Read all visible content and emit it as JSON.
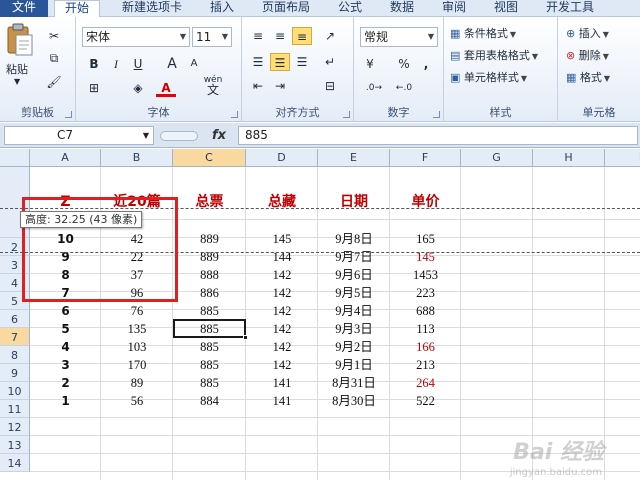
{
  "tabs": [
    "文件",
    "开始",
    "新建选项卡",
    "插入",
    "页面布局",
    "公式",
    "数据",
    "审阅",
    "视图",
    "开发工具"
  ],
  "ribbon": {
    "clipboard": {
      "label": "剪贴板",
      "paste": "粘贴"
    },
    "font": {
      "label": "字体",
      "name": "宋体",
      "size": "11",
      "bold": "B",
      "italic": "I",
      "underline": "U",
      "grow": "A",
      "shrink": "A",
      "color_a": "A",
      "wen": "wén",
      "wen_char": "文"
    },
    "align": {
      "label": "对齐方式"
    },
    "number": {
      "label": "数字",
      "format": "常规",
      "percent": "%",
      "comma": ","
    },
    "styles": {
      "label": "样式",
      "conditional": "条件格式",
      "table": "套用表格格式",
      "cell": "单元格样式"
    },
    "cells": {
      "label": "单元格",
      "insert": "插入",
      "delete": "删除",
      "format": "格式"
    }
  },
  "formula_bar": {
    "name_box": "C7",
    "fx": "fx",
    "value": "885"
  },
  "columns": [
    "A",
    "B",
    "C",
    "D",
    "E",
    "F",
    "G",
    "H",
    "I"
  ],
  "rows": [
    "2",
    "3",
    "4",
    "5",
    "6",
    "7",
    "8",
    "9",
    "10",
    "11",
    "12",
    "13",
    "14"
  ],
  "header_row": [
    "Z",
    "近20篇",
    "总票",
    "总藏",
    "日期",
    "单价"
  ],
  "table": [
    [
      "10",
      "42",
      "889",
      "145",
      "9月8日",
      "165"
    ],
    [
      "9",
      "22",
      "889",
      "144",
      "9月7日",
      "145"
    ],
    [
      "8",
      "37",
      "888",
      "142",
      "9月6日",
      "1453"
    ],
    [
      "7",
      "96",
      "886",
      "142",
      "9月5日",
      "223"
    ],
    [
      "6",
      "76",
      "885",
      "142",
      "9月4日",
      "688"
    ],
    [
      "5",
      "135",
      "885",
      "142",
      "9月3日",
      "113"
    ],
    [
      "4",
      "103",
      "885",
      "142",
      "9月2日",
      "166"
    ],
    [
      "3",
      "170",
      "885",
      "142",
      "9月1日",
      "213"
    ],
    [
      "2",
      "89",
      "885",
      "141",
      "8月31日",
      "264"
    ],
    [
      "1",
      "56",
      "884",
      "141",
      "8月30日",
      "522"
    ]
  ],
  "red_price_rows": [
    1,
    6,
    8
  ],
  "tooltip": "高度: 32.25 (43 像素)",
  "watermark": "Bai 经验",
  "watermark_sub": "jingyan.baidu.com",
  "colors": {
    "accent_red": "#c00000",
    "selection": "#f9d99f",
    "file_tab": "#2a5699"
  }
}
